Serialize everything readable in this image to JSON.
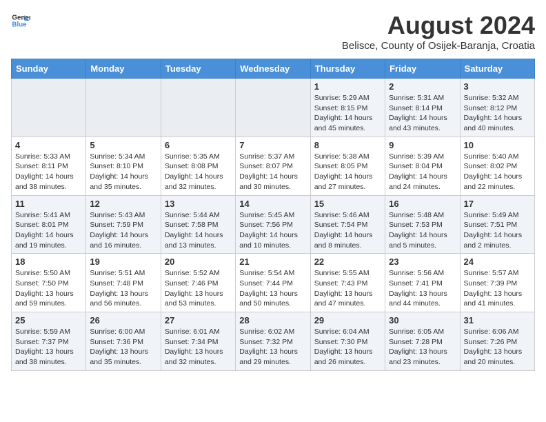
{
  "header": {
    "logo_general": "General",
    "logo_blue": "Blue",
    "month_year": "August 2024",
    "location": "Belisce, County of Osijek-Baranja, Croatia"
  },
  "weekdays": [
    "Sunday",
    "Monday",
    "Tuesday",
    "Wednesday",
    "Thursday",
    "Friday",
    "Saturday"
  ],
  "weeks": [
    [
      {
        "day": "",
        "info": ""
      },
      {
        "day": "",
        "info": ""
      },
      {
        "day": "",
        "info": ""
      },
      {
        "day": "",
        "info": ""
      },
      {
        "day": "1",
        "info": "Sunrise: 5:29 AM\nSunset: 8:15 PM\nDaylight: 14 hours\nand 45 minutes."
      },
      {
        "day": "2",
        "info": "Sunrise: 5:31 AM\nSunset: 8:14 PM\nDaylight: 14 hours\nand 43 minutes."
      },
      {
        "day": "3",
        "info": "Sunrise: 5:32 AM\nSunset: 8:12 PM\nDaylight: 14 hours\nand 40 minutes."
      }
    ],
    [
      {
        "day": "4",
        "info": "Sunrise: 5:33 AM\nSunset: 8:11 PM\nDaylight: 14 hours\nand 38 minutes."
      },
      {
        "day": "5",
        "info": "Sunrise: 5:34 AM\nSunset: 8:10 PM\nDaylight: 14 hours\nand 35 minutes."
      },
      {
        "day": "6",
        "info": "Sunrise: 5:35 AM\nSunset: 8:08 PM\nDaylight: 14 hours\nand 32 minutes."
      },
      {
        "day": "7",
        "info": "Sunrise: 5:37 AM\nSunset: 8:07 PM\nDaylight: 14 hours\nand 30 minutes."
      },
      {
        "day": "8",
        "info": "Sunrise: 5:38 AM\nSunset: 8:05 PM\nDaylight: 14 hours\nand 27 minutes."
      },
      {
        "day": "9",
        "info": "Sunrise: 5:39 AM\nSunset: 8:04 PM\nDaylight: 14 hours\nand 24 minutes."
      },
      {
        "day": "10",
        "info": "Sunrise: 5:40 AM\nSunset: 8:02 PM\nDaylight: 14 hours\nand 22 minutes."
      }
    ],
    [
      {
        "day": "11",
        "info": "Sunrise: 5:41 AM\nSunset: 8:01 PM\nDaylight: 14 hours\nand 19 minutes."
      },
      {
        "day": "12",
        "info": "Sunrise: 5:43 AM\nSunset: 7:59 PM\nDaylight: 14 hours\nand 16 minutes."
      },
      {
        "day": "13",
        "info": "Sunrise: 5:44 AM\nSunset: 7:58 PM\nDaylight: 14 hours\nand 13 minutes."
      },
      {
        "day": "14",
        "info": "Sunrise: 5:45 AM\nSunset: 7:56 PM\nDaylight: 14 hours\nand 10 minutes."
      },
      {
        "day": "15",
        "info": "Sunrise: 5:46 AM\nSunset: 7:54 PM\nDaylight: 14 hours\nand 8 minutes."
      },
      {
        "day": "16",
        "info": "Sunrise: 5:48 AM\nSunset: 7:53 PM\nDaylight: 14 hours\nand 5 minutes."
      },
      {
        "day": "17",
        "info": "Sunrise: 5:49 AM\nSunset: 7:51 PM\nDaylight: 14 hours\nand 2 minutes."
      }
    ],
    [
      {
        "day": "18",
        "info": "Sunrise: 5:50 AM\nSunset: 7:50 PM\nDaylight: 13 hours\nand 59 minutes."
      },
      {
        "day": "19",
        "info": "Sunrise: 5:51 AM\nSunset: 7:48 PM\nDaylight: 13 hours\nand 56 minutes."
      },
      {
        "day": "20",
        "info": "Sunrise: 5:52 AM\nSunset: 7:46 PM\nDaylight: 13 hours\nand 53 minutes."
      },
      {
        "day": "21",
        "info": "Sunrise: 5:54 AM\nSunset: 7:44 PM\nDaylight: 13 hours\nand 50 minutes."
      },
      {
        "day": "22",
        "info": "Sunrise: 5:55 AM\nSunset: 7:43 PM\nDaylight: 13 hours\nand 47 minutes."
      },
      {
        "day": "23",
        "info": "Sunrise: 5:56 AM\nSunset: 7:41 PM\nDaylight: 13 hours\nand 44 minutes."
      },
      {
        "day": "24",
        "info": "Sunrise: 5:57 AM\nSunset: 7:39 PM\nDaylight: 13 hours\nand 41 minutes."
      }
    ],
    [
      {
        "day": "25",
        "info": "Sunrise: 5:59 AM\nSunset: 7:37 PM\nDaylight: 13 hours\nand 38 minutes."
      },
      {
        "day": "26",
        "info": "Sunrise: 6:00 AM\nSunset: 7:36 PM\nDaylight: 13 hours\nand 35 minutes."
      },
      {
        "day": "27",
        "info": "Sunrise: 6:01 AM\nSunset: 7:34 PM\nDaylight: 13 hours\nand 32 minutes."
      },
      {
        "day": "28",
        "info": "Sunrise: 6:02 AM\nSunset: 7:32 PM\nDaylight: 13 hours\nand 29 minutes."
      },
      {
        "day": "29",
        "info": "Sunrise: 6:04 AM\nSunset: 7:30 PM\nDaylight: 13 hours\nand 26 minutes."
      },
      {
        "day": "30",
        "info": "Sunrise: 6:05 AM\nSunset: 7:28 PM\nDaylight: 13 hours\nand 23 minutes."
      },
      {
        "day": "31",
        "info": "Sunrise: 6:06 AM\nSunset: 7:26 PM\nDaylight: 13 hours\nand 20 minutes."
      }
    ]
  ]
}
